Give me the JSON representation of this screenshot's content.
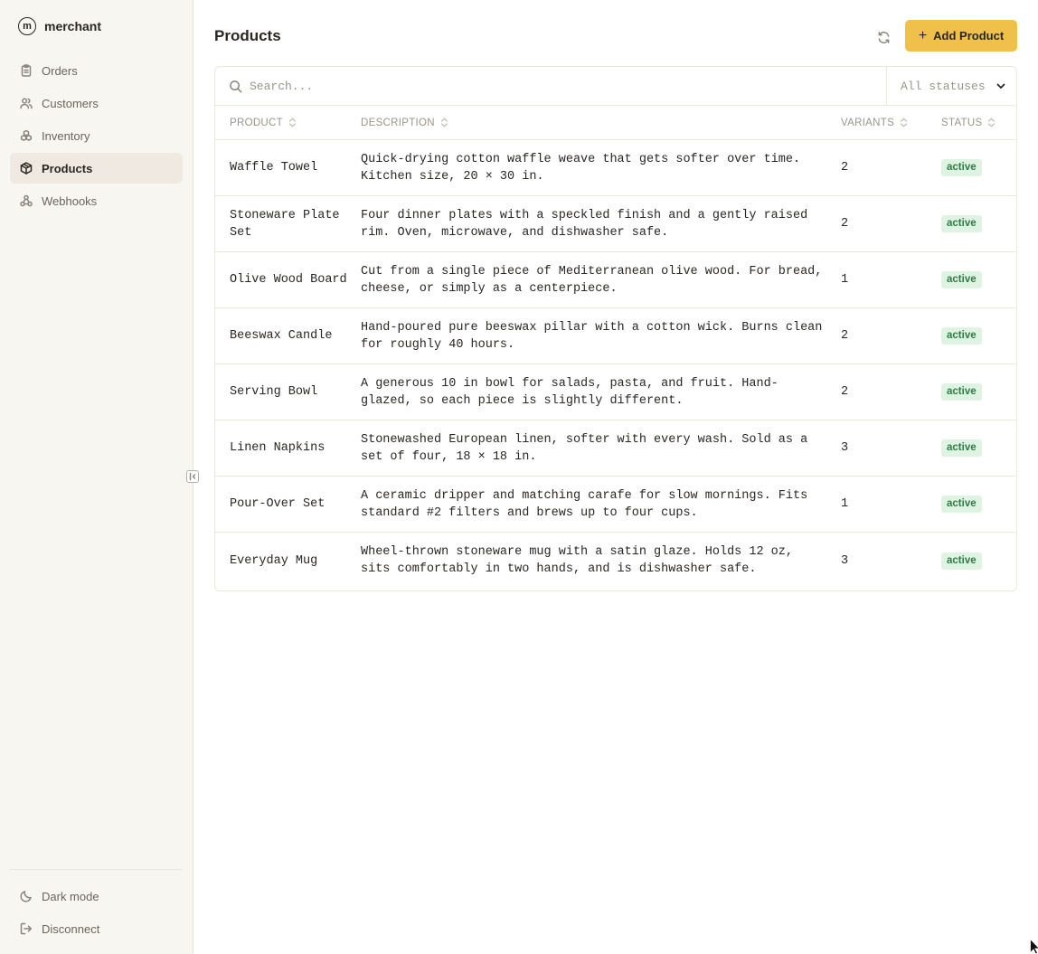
{
  "brand": {
    "logo_letter": "m",
    "name": "merchant"
  },
  "nav": [
    {
      "label": "Orders",
      "icon": "clipboard-icon",
      "active": false
    },
    {
      "label": "Customers",
      "icon": "users-icon",
      "active": false
    },
    {
      "label": "Inventory",
      "icon": "boxes-icon",
      "active": false
    },
    {
      "label": "Products",
      "icon": "package-icon",
      "active": true
    },
    {
      "label": "Webhooks",
      "icon": "webhook-icon",
      "active": false
    }
  ],
  "footer": {
    "dark_mode_label": "Dark mode",
    "disconnect_label": "Disconnect"
  },
  "header": {
    "title": "Products",
    "add_button_label": "Add Product"
  },
  "toolbar": {
    "search_placeholder": "Search...",
    "search_value": "",
    "status_filter": "All statuses"
  },
  "table": {
    "columns": [
      "PRODUCT",
      "DESCRIPTION",
      "VARIANTS",
      "STATUS"
    ],
    "rows": [
      {
        "product": "Waffle Towel",
        "description": "Quick-drying cotton waffle weave that gets softer over time. Kitchen size, 20 × 30 in.",
        "variants": "2",
        "status": "active"
      },
      {
        "product": "Stoneware Plate Set",
        "description": "Four dinner plates with a speckled finish and a gently raised rim. Oven, microwave, and dishwasher safe.",
        "variants": "2",
        "status": "active"
      },
      {
        "product": "Olive Wood Board",
        "description": "Cut from a single piece of Mediterranean olive wood. For bread, cheese, or simply as a centerpiece.",
        "variants": "1",
        "status": "active"
      },
      {
        "product": "Beeswax Candle",
        "description": "Hand-poured pure beeswax pillar with a cotton wick. Burns clean for roughly 40 hours.",
        "variants": "2",
        "status": "active"
      },
      {
        "product": "Serving Bowl",
        "description": "A generous 10 in bowl for salads, pasta, and fruit. Hand-glazed, so each piece is slightly different.",
        "variants": "2",
        "status": "active"
      },
      {
        "product": "Linen Napkins",
        "description": "Stonewashed European linen, softer with every wash. Sold as a set of four, 18 × 18 in.",
        "variants": "3",
        "status": "active"
      },
      {
        "product": "Pour-Over Set",
        "description": "A ceramic dripper and matching carafe for slow mornings. Fits standard #2 filters and brews up to four cups.",
        "variants": "1",
        "status": "active"
      },
      {
        "product": "Everyday Mug",
        "description": "Wheel-thrown stoneware mug with a satin glaze. Holds 12 oz, sits comfortably in two hands, and is dishwasher safe.",
        "variants": "3",
        "status": "active"
      }
    ]
  },
  "colors": {
    "accent": "#efc14a",
    "sidebar_bg": "#f8f6f1",
    "active_nav_bg": "#efe9e1",
    "badge_bg": "#dff3e2",
    "badge_text": "#2e7b45"
  }
}
